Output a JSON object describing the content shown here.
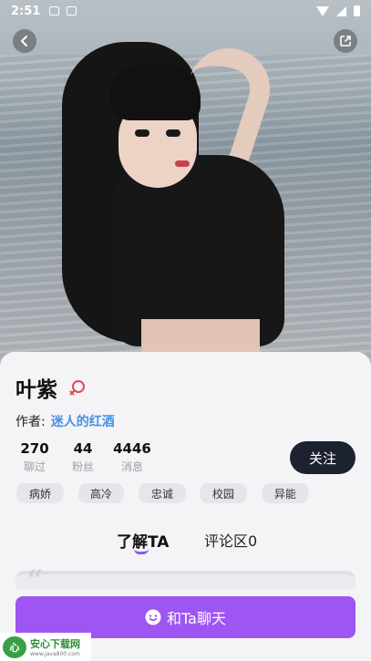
{
  "status_bar": {
    "time": "2:51"
  },
  "profile": {
    "name": "叶紫",
    "author_label": "作者:",
    "author_name": "迷人的红酒",
    "stats": [
      {
        "value": "270",
        "label": "聊过"
      },
      {
        "value": "44",
        "label": "粉丝"
      },
      {
        "value": "4446",
        "label": "消息"
      }
    ],
    "follow_label": "关注",
    "tags": [
      "病娇",
      "高冷",
      "忠诚",
      "校园",
      "异能"
    ]
  },
  "tabs": [
    {
      "label": "了解TA",
      "active": true
    },
    {
      "label": "评论区0",
      "active": false
    }
  ],
  "quote_mark": "“",
  "chat_button": {
    "label": "和Ta聊天"
  },
  "watermark": {
    "logo": "心",
    "title": "安心下载网",
    "url": "www.java800.com"
  },
  "colors": {
    "accent": "#9e55f2",
    "follow_bg": "#1c2230",
    "author_link": "#4a8fe0",
    "gender_icon": "#e0485a"
  }
}
